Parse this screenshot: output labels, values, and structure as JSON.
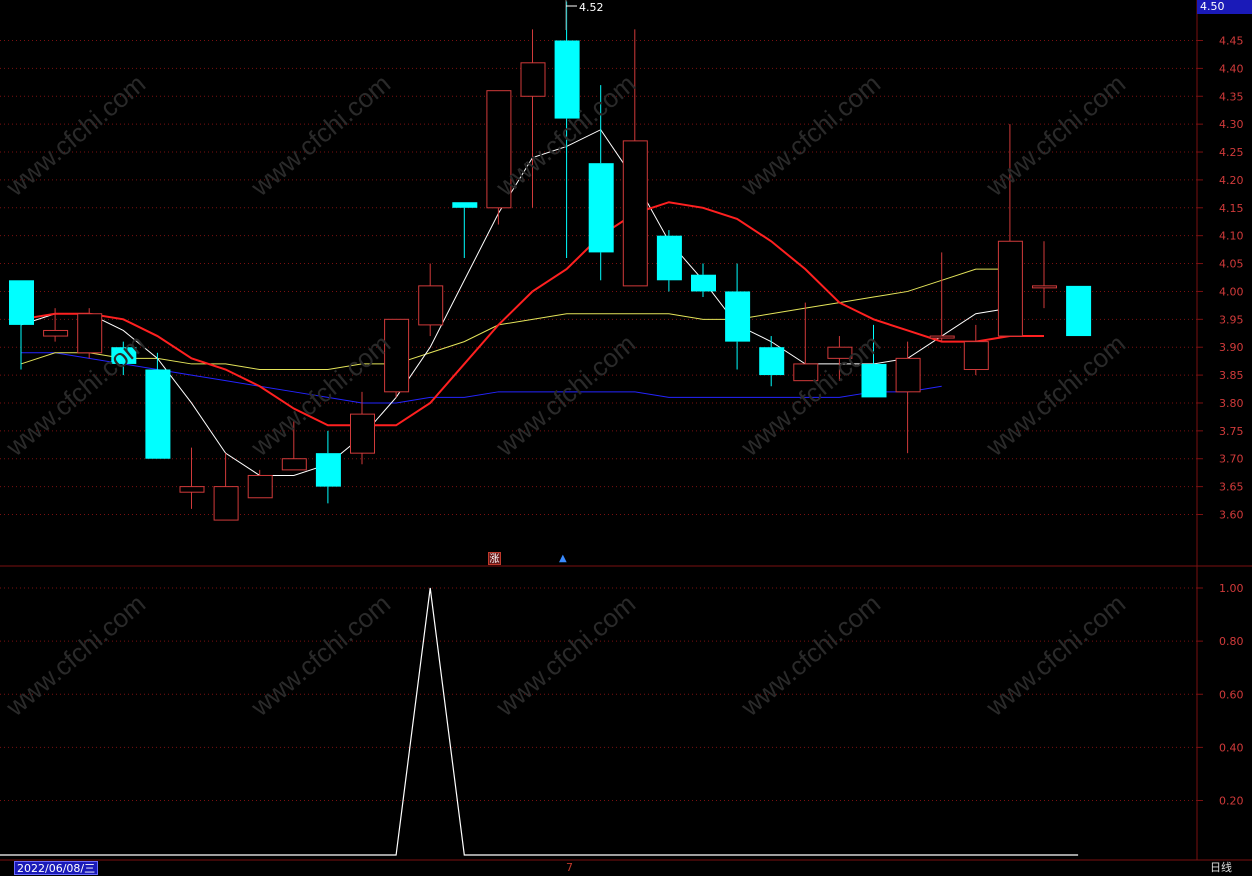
{
  "header": {
    "last_price": "4.50",
    "high_marker": "4.52"
  },
  "footer": {
    "date": "2022/06/08/三",
    "period": "日线",
    "cursor_label": "7"
  },
  "tags": {
    "zhang": "涨",
    "arrow": "▲"
  },
  "watermark": "www.cfchi.com",
  "colors": {
    "up": "#d03a3a",
    "down": "#00ffff",
    "ma_white": "#ffffff",
    "ma_yellow": "#e4e45a",
    "ma_red": "#ff2020",
    "ma_blue": "#2424ff",
    "grid": "#7a1010",
    "axis_text": "#d03a3a",
    "indicator": "#ffffff"
  },
  "chart_data": [
    {
      "type": "candlestick",
      "ylim": [
        3.55,
        4.52
      ],
      "yticks": [
        3.6,
        3.65,
        3.7,
        3.75,
        3.8,
        3.85,
        3.9,
        3.95,
        4.0,
        4.05,
        4.1,
        4.15,
        4.2,
        4.25,
        4.3,
        4.35,
        4.4,
        4.45
      ],
      "ytick_labels": [
        "3.60",
        "3.65",
        "3.70",
        "3.75",
        "3.80",
        "3.85",
        "3.90",
        "3.95",
        "4.00",
        "4.05",
        "4.10",
        "4.15",
        "4.20",
        "4.25",
        "4.30",
        "4.35",
        "4.40",
        "4.45"
      ],
      "grid": true,
      "candles": [
        {
          "o": 4.02,
          "h": 4.02,
          "l": 3.86,
          "c": 3.94
        },
        {
          "o": 3.92,
          "h": 3.97,
          "l": 3.91,
          "c": 3.93
        },
        {
          "o": 3.89,
          "h": 3.97,
          "l": 3.88,
          "c": 3.96
        },
        {
          "o": 3.9,
          "h": 3.91,
          "l": 3.85,
          "c": 3.87
        },
        {
          "o": 3.86,
          "h": 3.89,
          "l": 3.7,
          "c": 3.7
        },
        {
          "o": 3.64,
          "h": 3.72,
          "l": 3.61,
          "c": 3.65
        },
        {
          "o": 3.59,
          "h": 3.71,
          "l": 3.59,
          "c": 3.65
        },
        {
          "o": 3.63,
          "h": 3.68,
          "l": 3.63,
          "c": 3.67
        },
        {
          "o": 3.68,
          "h": 3.77,
          "l": 3.68,
          "c": 3.7
        },
        {
          "o": 3.71,
          "h": 3.75,
          "l": 3.62,
          "c": 3.65
        },
        {
          "o": 3.71,
          "h": 3.82,
          "l": 3.69,
          "c": 3.78
        },
        {
          "o": 3.82,
          "h": 3.95,
          "l": 3.81,
          "c": 3.95
        },
        {
          "o": 3.94,
          "h": 4.05,
          "l": 3.92,
          "c": 4.01
        },
        {
          "o": 4.16,
          "h": 4.16,
          "l": 4.06,
          "c": 4.15
        },
        {
          "o": 4.15,
          "h": 4.36,
          "l": 4.12,
          "c": 4.36
        },
        {
          "o": 4.35,
          "h": 4.47,
          "l": 4.15,
          "c": 4.41
        },
        {
          "o": 4.45,
          "h": 4.52,
          "l": 4.06,
          "c": 4.31
        },
        {
          "o": 4.23,
          "h": 4.37,
          "l": 4.02,
          "c": 4.07
        },
        {
          "o": 4.01,
          "h": 4.47,
          "l": 4.01,
          "c": 4.27
        },
        {
          "o": 4.1,
          "h": 4.11,
          "l": 4.0,
          "c": 4.02
        },
        {
          "o": 4.03,
          "h": 4.05,
          "l": 3.99,
          "c": 4.0
        },
        {
          "o": 4.0,
          "h": 4.05,
          "l": 3.86,
          "c": 3.91
        },
        {
          "o": 3.9,
          "h": 3.92,
          "l": 3.83,
          "c": 3.85
        },
        {
          "o": 3.84,
          "h": 3.98,
          "l": 3.84,
          "c": 3.87
        },
        {
          "o": 3.88,
          "h": 3.92,
          "l": 3.84,
          "c": 3.9
        },
        {
          "o": 3.87,
          "h": 3.94,
          "l": 3.81,
          "c": 3.81
        },
        {
          "o": 3.82,
          "h": 3.91,
          "l": 3.71,
          "c": 3.88
        },
        {
          "o": 3.92,
          "h": 4.07,
          "l": 3.91,
          "c": 3.92
        },
        {
          "o": 3.86,
          "h": 3.94,
          "l": 3.85,
          "c": 3.91
        },
        {
          "o": 3.92,
          "h": 4.3,
          "l": 3.92,
          "c": 4.09
        },
        {
          "o": 4.01,
          "h": 4.09,
          "l": 3.97,
          "c": 4.01
        },
        {
          "o": 4.01,
          "h": 4.01,
          "l": 3.92,
          "c": 3.92
        }
      ],
      "ma_white": [
        3.94,
        3.96,
        3.96,
        3.93,
        3.88,
        3.8,
        3.71,
        3.67,
        3.67,
        3.69,
        3.74,
        3.81,
        3.9,
        4.02,
        4.14,
        4.24,
        4.26,
        4.29,
        4.2,
        4.09,
        4.02,
        3.94,
        3.91,
        3.87,
        3.87,
        3.87,
        3.88,
        3.92,
        3.96,
        3.97
      ],
      "ma_yellow": [
        3.87,
        3.89,
        3.89,
        3.88,
        3.88,
        3.87,
        3.87,
        3.86,
        3.86,
        3.86,
        3.87,
        3.87,
        3.89,
        3.91,
        3.94,
        3.95,
        3.96,
        3.96,
        3.96,
        3.96,
        3.95,
        3.95,
        3.96,
        3.97,
        3.98,
        3.99,
        4.0,
        4.02,
        4.04,
        4.04
      ],
      "ma_red": [
        3.95,
        3.96,
        3.96,
        3.95,
        3.92,
        3.88,
        3.86,
        3.83,
        3.79,
        3.76,
        3.76,
        3.76,
        3.8,
        3.87,
        3.94,
        4.0,
        4.04,
        4.1,
        4.14,
        4.16,
        4.15,
        4.13,
        4.09,
        4.04,
        3.98,
        3.95,
        3.93,
        3.91,
        3.91,
        3.92,
        3.92
      ],
      "ma_blue": [
        3.89,
        3.89,
        3.88,
        3.87,
        3.86,
        3.85,
        3.84,
        3.83,
        3.82,
        3.81,
        3.8,
        3.8,
        3.81,
        3.81,
        3.82,
        3.82,
        3.82,
        3.82,
        3.82,
        3.81,
        3.81,
        3.81,
        3.81,
        3.81,
        3.81,
        3.82,
        3.82,
        3.83
      ]
    },
    {
      "type": "line",
      "ylim": [
        0,
        1.05
      ],
      "yticks": [
        0.2,
        0.4,
        0.6,
        0.8,
        1.0
      ],
      "ytick_labels": [
        "0.20",
        "0.40",
        "0.60",
        "0.80",
        "1.00"
      ],
      "grid": true,
      "values": [
        0,
        0,
        0,
        0,
        0,
        0,
        0,
        0,
        0,
        0,
        0,
        0,
        1,
        0,
        0,
        0,
        0,
        0,
        0,
        0,
        0,
        0,
        0,
        0,
        0,
        0,
        0,
        0,
        0,
        0,
        0,
        0
      ]
    }
  ]
}
